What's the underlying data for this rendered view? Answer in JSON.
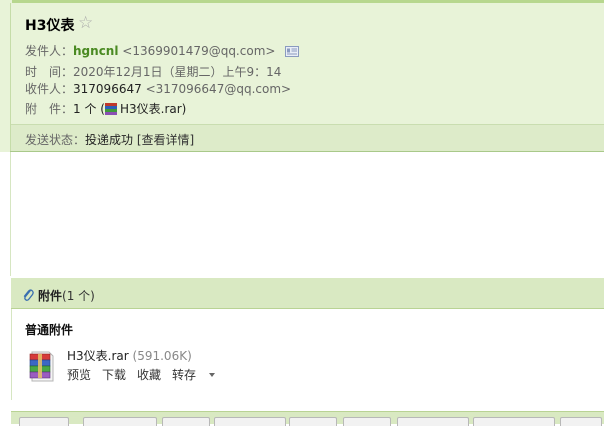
{
  "email": {
    "subject": "H3仪表",
    "star_glyph": "☆",
    "from_label": "发件人：",
    "from_name": "hgncnl",
    "from_address": "<1369901479@qq.com>",
    "time_label": "时　间：",
    "time_value": "2020年12月1日（星期二）上午9：14",
    "to_label": "收件人：",
    "to_name": "317096647",
    "to_address": "<317096647@qq.com>",
    "attach_label": "附　件：",
    "attach_count": "1 个 (",
    "attach_filename": "H3仪表.rar",
    "attach_close": ")",
    "status_label": "发送状态：",
    "status_value": "投递成功",
    "status_link": "[查看详情]"
  },
  "attachments": {
    "header_bold": "附件",
    "header_count": "(1 个)",
    "section_label": "普通附件",
    "files": [
      {
        "name": "H3仪表.rar",
        "size": "(591.06K)",
        "actions": [
          "预览",
          "下载",
          "收藏",
          "转存"
        ]
      }
    ]
  },
  "colors": {
    "header_bg": "#e8f3d8",
    "sender_green": "#4a8a22",
    "attach_header_bg": "#d9e9c2"
  },
  "icons": {
    "star": "star-icon",
    "vcard": "contact-card-icon",
    "rar": "rar-archive-icon",
    "paperclip": "paperclip-icon",
    "dropdown": "chevron-down-icon"
  }
}
